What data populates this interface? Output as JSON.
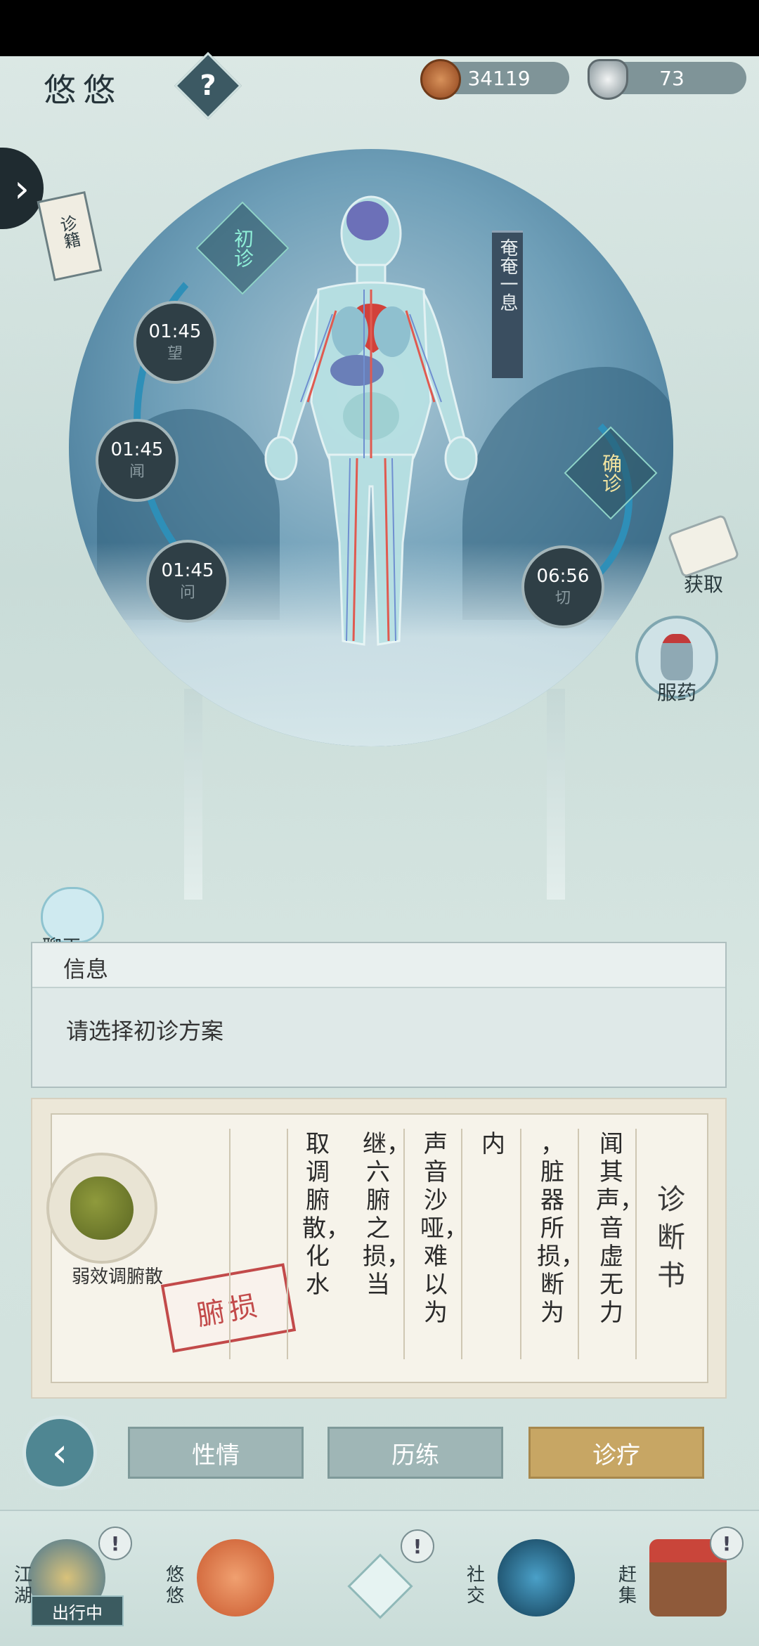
{
  "header": {
    "title": "悠悠",
    "help_icon": "?",
    "coins": "34119",
    "ingots": "73"
  },
  "sidebar": {
    "book_label": "诊籍"
  },
  "diagnosis_stage": {
    "initial": "初诊",
    "confirm": "确诊",
    "banner": "奄奄一息"
  },
  "timers": [
    {
      "time": "01:45",
      "label": "望"
    },
    {
      "time": "01:45",
      "label": "闻"
    },
    {
      "time": "01:45",
      "label": "问"
    },
    {
      "time": "06:56",
      "label": "切"
    }
  ],
  "right_actions": {
    "obtain": "获取",
    "medicine": "服药"
  },
  "chat": {
    "label": "聊天"
  },
  "info": {
    "header": "信息",
    "message": "请选择初诊方案"
  },
  "diagnosis_book": {
    "title": "诊断书",
    "herb_name": "弱效调腑散",
    "stamp": "腑损",
    "columns": [
      "闻其声，音虚无力",
      "，脏器所损，断为",
      "内",
      "声音沙哑，难以为",
      "继，六腑之损，当",
      "取调腑散，化水"
    ]
  },
  "tabs": [
    {
      "label": "性情",
      "active": false
    },
    {
      "label": "历练",
      "active": false
    },
    {
      "label": "诊疗",
      "active": true
    }
  ],
  "dock": {
    "jianghu": "江湖",
    "youyou": "悠悠",
    "social": "社交",
    "market": "赶集",
    "outing": "出行中",
    "alert": "!"
  },
  "colors": {
    "active_tab": "#c7a664",
    "tab": "#9fb6b6",
    "disc": "#4a7d9b"
  }
}
